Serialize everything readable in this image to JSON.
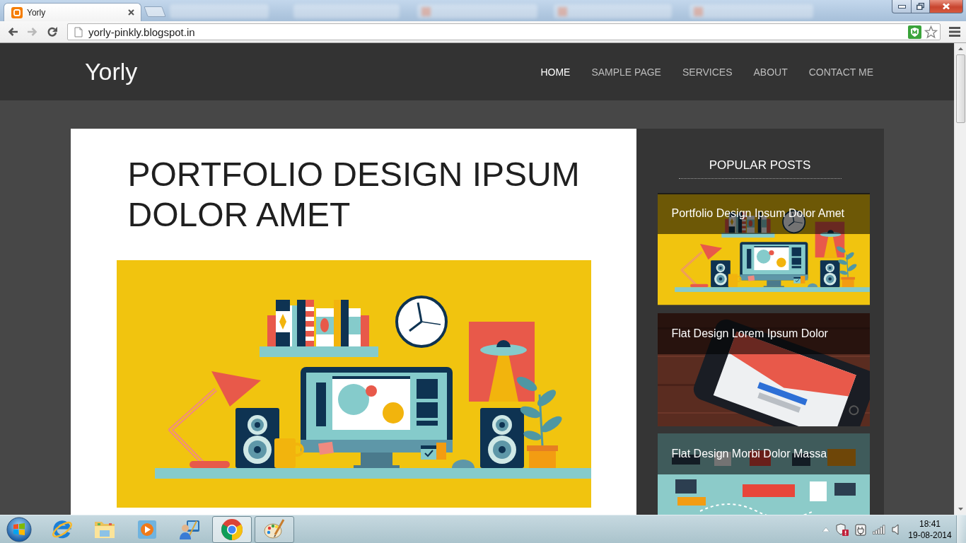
{
  "browser": {
    "tabs": [
      {
        "title": "Yorly",
        "selected": true
      }
    ],
    "nav_buttons": [
      {
        "kind": "back",
        "disabled": false
      },
      {
        "kind": "forward",
        "disabled": true
      },
      {
        "kind": "reload",
        "disabled": false
      }
    ],
    "address": "yorly-pinkly.blogspot.in"
  },
  "site": {
    "logo": "Yorly",
    "nav": [
      {
        "label": "HOME",
        "selected": true
      },
      {
        "label": "SAMPLE PAGE",
        "selected": false
      },
      {
        "label": "SERVICES",
        "selected": false
      },
      {
        "label": "ABOUT",
        "selected": false
      },
      {
        "label": "CONTACT ME",
        "selected": false
      }
    ]
  },
  "post": {
    "title": "PORTFOLIO DESIGN IPSUM DOLOR AMET"
  },
  "sidebar": {
    "heading": "POPULAR POSTS",
    "posts": [
      {
        "title": "Portfolio Design Ipsum Dolor Amet",
        "kind": "desk"
      },
      {
        "title": "Flat Design Lorem Ipsum Dolor",
        "kind": "phone"
      },
      {
        "title": "Flat Design Morbi Dolor Massa",
        "kind": "infographic"
      }
    ]
  },
  "taskbar": {
    "apps": [
      {
        "kind": "ie",
        "open": false,
        "active": false
      },
      {
        "kind": "explorer",
        "open": false,
        "active": false
      },
      {
        "kind": "media",
        "open": false,
        "active": false
      },
      {
        "kind": "user",
        "open": false,
        "active": false
      },
      {
        "kind": "chrome",
        "open": true,
        "active": true
      },
      {
        "kind": "paint",
        "open": true,
        "active": false
      }
    ],
    "clock": {
      "time": "18:41",
      "date": "19-08-2014"
    }
  }
}
